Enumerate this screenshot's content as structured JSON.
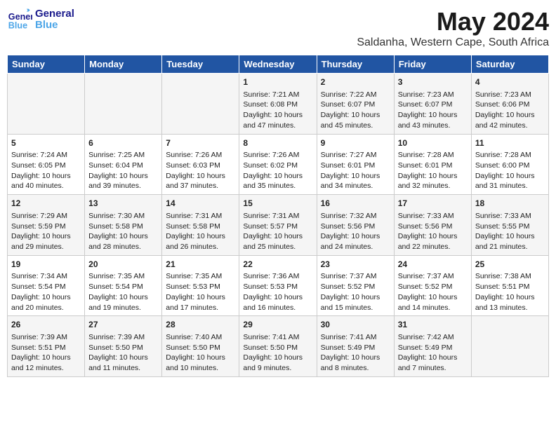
{
  "header": {
    "logo": {
      "line1": "General",
      "line2": "Blue"
    },
    "month": "May 2024",
    "location": "Saldanha, Western Cape, South Africa"
  },
  "weekdays": [
    "Sunday",
    "Monday",
    "Tuesday",
    "Wednesday",
    "Thursday",
    "Friday",
    "Saturday"
  ],
  "weeks": [
    [
      {
        "day": "",
        "info": ""
      },
      {
        "day": "",
        "info": ""
      },
      {
        "day": "",
        "info": ""
      },
      {
        "day": "1",
        "info": "Sunrise: 7:21 AM\nSunset: 6:08 PM\nDaylight: 10 hours\nand 47 minutes."
      },
      {
        "day": "2",
        "info": "Sunrise: 7:22 AM\nSunset: 6:07 PM\nDaylight: 10 hours\nand 45 minutes."
      },
      {
        "day": "3",
        "info": "Sunrise: 7:23 AM\nSunset: 6:07 PM\nDaylight: 10 hours\nand 43 minutes."
      },
      {
        "day": "4",
        "info": "Sunrise: 7:23 AM\nSunset: 6:06 PM\nDaylight: 10 hours\nand 42 minutes."
      }
    ],
    [
      {
        "day": "5",
        "info": "Sunrise: 7:24 AM\nSunset: 6:05 PM\nDaylight: 10 hours\nand 40 minutes."
      },
      {
        "day": "6",
        "info": "Sunrise: 7:25 AM\nSunset: 6:04 PM\nDaylight: 10 hours\nand 39 minutes."
      },
      {
        "day": "7",
        "info": "Sunrise: 7:26 AM\nSunset: 6:03 PM\nDaylight: 10 hours\nand 37 minutes."
      },
      {
        "day": "8",
        "info": "Sunrise: 7:26 AM\nSunset: 6:02 PM\nDaylight: 10 hours\nand 35 minutes."
      },
      {
        "day": "9",
        "info": "Sunrise: 7:27 AM\nSunset: 6:01 PM\nDaylight: 10 hours\nand 34 minutes."
      },
      {
        "day": "10",
        "info": "Sunrise: 7:28 AM\nSunset: 6:01 PM\nDaylight: 10 hours\nand 32 minutes."
      },
      {
        "day": "11",
        "info": "Sunrise: 7:28 AM\nSunset: 6:00 PM\nDaylight: 10 hours\nand 31 minutes."
      }
    ],
    [
      {
        "day": "12",
        "info": "Sunrise: 7:29 AM\nSunset: 5:59 PM\nDaylight: 10 hours\nand 29 minutes."
      },
      {
        "day": "13",
        "info": "Sunrise: 7:30 AM\nSunset: 5:58 PM\nDaylight: 10 hours\nand 28 minutes."
      },
      {
        "day": "14",
        "info": "Sunrise: 7:31 AM\nSunset: 5:58 PM\nDaylight: 10 hours\nand 26 minutes."
      },
      {
        "day": "15",
        "info": "Sunrise: 7:31 AM\nSunset: 5:57 PM\nDaylight: 10 hours\nand 25 minutes."
      },
      {
        "day": "16",
        "info": "Sunrise: 7:32 AM\nSunset: 5:56 PM\nDaylight: 10 hours\nand 24 minutes."
      },
      {
        "day": "17",
        "info": "Sunrise: 7:33 AM\nSunset: 5:56 PM\nDaylight: 10 hours\nand 22 minutes."
      },
      {
        "day": "18",
        "info": "Sunrise: 7:33 AM\nSunset: 5:55 PM\nDaylight: 10 hours\nand 21 minutes."
      }
    ],
    [
      {
        "day": "19",
        "info": "Sunrise: 7:34 AM\nSunset: 5:54 PM\nDaylight: 10 hours\nand 20 minutes."
      },
      {
        "day": "20",
        "info": "Sunrise: 7:35 AM\nSunset: 5:54 PM\nDaylight: 10 hours\nand 19 minutes."
      },
      {
        "day": "21",
        "info": "Sunrise: 7:35 AM\nSunset: 5:53 PM\nDaylight: 10 hours\nand 17 minutes."
      },
      {
        "day": "22",
        "info": "Sunrise: 7:36 AM\nSunset: 5:53 PM\nDaylight: 10 hours\nand 16 minutes."
      },
      {
        "day": "23",
        "info": "Sunrise: 7:37 AM\nSunset: 5:52 PM\nDaylight: 10 hours\nand 15 minutes."
      },
      {
        "day": "24",
        "info": "Sunrise: 7:37 AM\nSunset: 5:52 PM\nDaylight: 10 hours\nand 14 minutes."
      },
      {
        "day": "25",
        "info": "Sunrise: 7:38 AM\nSunset: 5:51 PM\nDaylight: 10 hours\nand 13 minutes."
      }
    ],
    [
      {
        "day": "26",
        "info": "Sunrise: 7:39 AM\nSunset: 5:51 PM\nDaylight: 10 hours\nand 12 minutes."
      },
      {
        "day": "27",
        "info": "Sunrise: 7:39 AM\nSunset: 5:50 PM\nDaylight: 10 hours\nand 11 minutes."
      },
      {
        "day": "28",
        "info": "Sunrise: 7:40 AM\nSunset: 5:50 PM\nDaylight: 10 hours\nand 10 minutes."
      },
      {
        "day": "29",
        "info": "Sunrise: 7:41 AM\nSunset: 5:50 PM\nDaylight: 10 hours\nand 9 minutes."
      },
      {
        "day": "30",
        "info": "Sunrise: 7:41 AM\nSunset: 5:49 PM\nDaylight: 10 hours\nand 8 minutes."
      },
      {
        "day": "31",
        "info": "Sunrise: 7:42 AM\nSunset: 5:49 PM\nDaylight: 10 hours\nand 7 minutes."
      },
      {
        "day": "",
        "info": ""
      }
    ]
  ]
}
